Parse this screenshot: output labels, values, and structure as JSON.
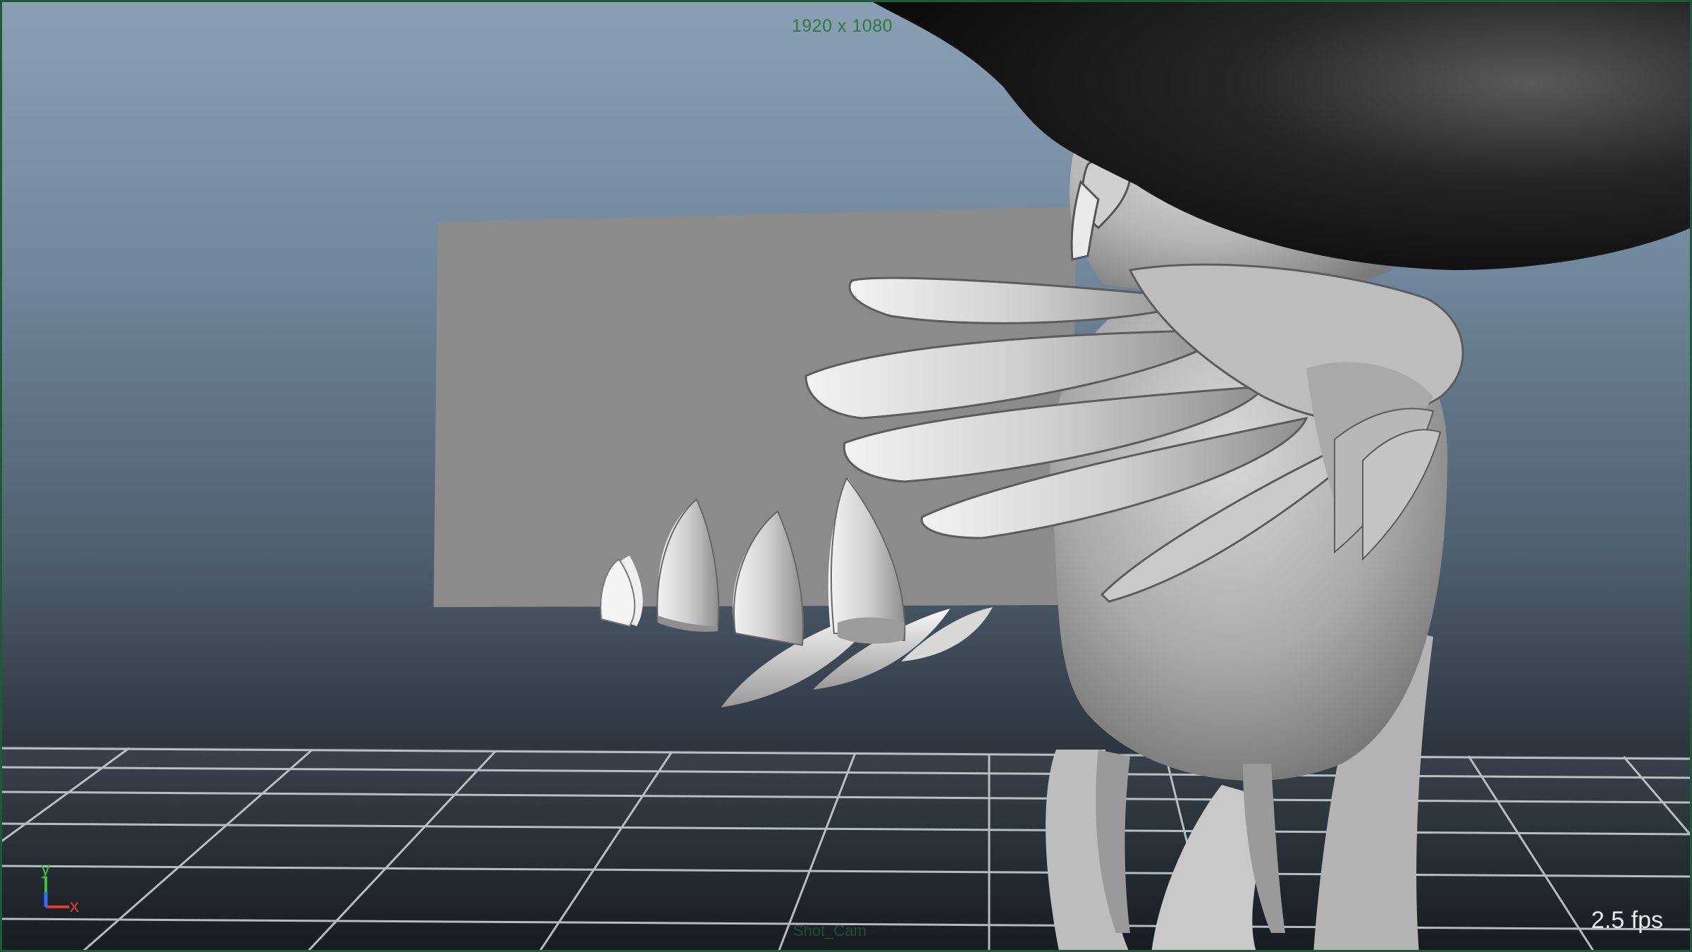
{
  "viewport": {
    "resolution_gate_label": "1920 x 1080",
    "fps_label": "2.5 fps",
    "camera_label": "Shot_Cam",
    "axis": {
      "y": "y",
      "x": "x"
    },
    "colors": {
      "hud_text": "#2f7a3a",
      "fps_text": "#e9ecef",
      "axis_y": "#3fbf3f",
      "axis_x": "#e03a2a",
      "axis_z": "#3a6bff"
    }
  }
}
